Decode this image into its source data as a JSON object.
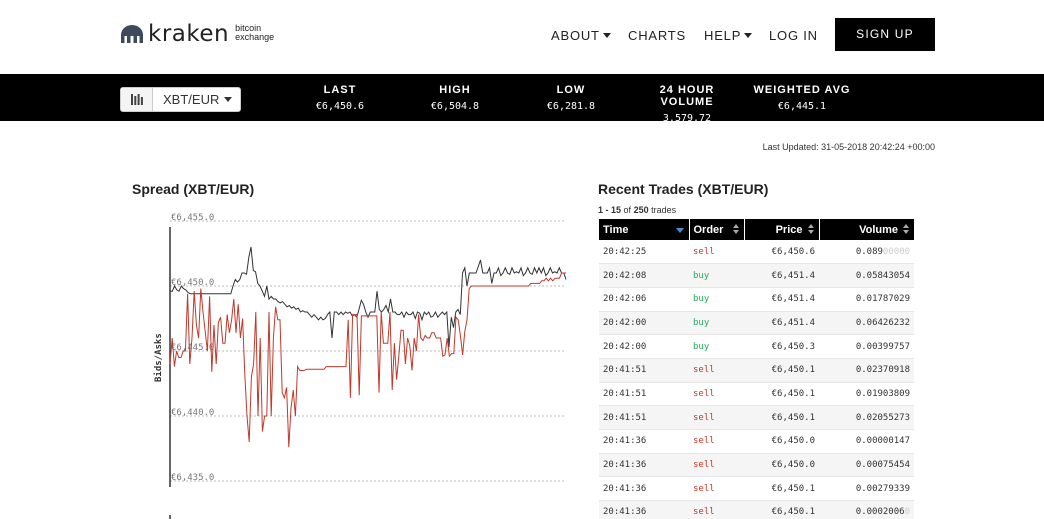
{
  "header": {
    "logo_word": "kraken",
    "logo_sub_1": "bitcoin",
    "logo_sub_2": "exchange",
    "nav": {
      "about": "ABOUT",
      "charts": "CHARTS",
      "help": "HELP",
      "login": "LOG IN",
      "signup": "SIGN UP"
    }
  },
  "ticker": {
    "pair": "XBT/EUR",
    "stats": [
      {
        "label": "LAST",
        "value": "€6,450.6"
      },
      {
        "label": "HIGH",
        "value": "€6,504.8"
      },
      {
        "label": "LOW",
        "value": "€6,281.8"
      },
      {
        "label": "24 HOUR VOLUME",
        "value": "3,579.72"
      },
      {
        "label": "WEIGHTED AVG",
        "value": "€6,445.1"
      }
    ]
  },
  "last_updated": "Last Updated: 31-05-2018 20:42:24 +00:00",
  "spread": {
    "title": "Spread (XBT/EUR)"
  },
  "chart_data": {
    "type": "line",
    "title": "Spread (XBT/EUR)",
    "ylabel": "Bids/Asks",
    "xlabel": "",
    "ylim": [
      6435.0,
      6455.0
    ],
    "yticks": [
      "€6,455.0",
      "€6,450.0",
      "€6,445.0",
      "€6,440.0",
      "€6,435.0"
    ],
    "series": [
      {
        "color": "#333333",
        "values": [
          6449.6,
          6449.6,
          6450.0,
          6449.7,
          6449.6,
          6450.0,
          6449.8,
          6449.7,
          6449.5,
          6449.4,
          6449.4,
          6449.4,
          6449.4,
          6449.4,
          6449.4,
          6449.4,
          6449.4,
          6449.4,
          6449.4,
          6449.4,
          6449.4,
          6449.4,
          6449.4,
          6449.4,
          6449.4,
          6449.4,
          6449.4,
          6449.4,
          6450.0,
          6450.5,
          6450.3,
          6450.5,
          6451.0,
          6451.0,
          6450.9,
          6452.2,
          6453.0,
          6451.2,
          6451.1,
          6450.2,
          6450.0,
          6449.6,
          6449.2,
          6450.0,
          6449.0,
          6449.2,
          6449.0,
          6449.0,
          6448.8,
          6448.7,
          6448.8,
          6448.6,
          6448.4,
          6448.5,
          6448.3,
          6448.4,
          6448.2,
          6448.3,
          6448.0,
          6448.1,
          6448.0,
          6448.0,
          6447.8,
          6447.6,
          6447.8,
          6447.6,
          6447.4,
          6447.6,
          6447.4,
          6447.5,
          6447.8,
          6448.0,
          6446.0,
          6448.0,
          6448.0,
          6447.8,
          6448.0,
          6447.8,
          6448.0,
          6447.9,
          6448.0,
          6447.7,
          6447.8,
          6447.6,
          6448.2,
          6448.9,
          6448.6,
          6448.0,
          6447.6,
          6448.0,
          6448.0,
          6448.0,
          6449.6,
          6448.2,
          6448.0,
          6448.2,
          6448.5,
          6448.0,
          6449.0,
          6448.0,
          6448.0,
          6447.8,
          6447.8,
          6448.0,
          6447.6,
          6448.0,
          6447.8,
          6447.8,
          6448.0,
          6447.5,
          6448.0,
          6447.9,
          6447.4,
          6448.0,
          6447.8,
          6448.0,
          6447.6,
          6447.7,
          6448.0,
          6447.6,
          6447.8,
          6448.0,
          6447.8,
          6448.0,
          6445.3,
          6447.6,
          6446.8,
          6448.0,
          6448.2,
          6447.8,
          6451.0,
          6451.4,
          6450.0,
          6451.0,
          6451.0,
          6451.0,
          6451.0,
          6451.5,
          6452.0,
          6451.0,
          6451.0,
          6451.0,
          6451.4,
          6450.2,
          6451.0,
          6451.0,
          6451.4,
          6450.8,
          6451.0,
          6451.4,
          6451.0,
          6450.9,
          6451.4,
          6451.0,
          6451.1,
          6451.0,
          6451.4,
          6450.8,
          6451.0,
          6451.4,
          6451.0,
          6450.9,
          6451.4,
          6451.0,
          6451.4,
          6451.0,
          6451.4,
          6450.8,
          6451.0,
          6451.4,
          6451.0,
          6451.1,
          6451.0,
          6451.4,
          6451.0,
          6451.0,
          6450.5
        ]
      },
      {
        "color": "#c0392b",
        "values": [
          6444.0,
          6446.0,
          6443.8,
          6445.0,
          6444.5,
          6444.5,
          6445.0,
          6445.0,
          6449.4,
          6444.0,
          6446.0,
          6449.6,
          6447.0,
          6446.0,
          6449.8,
          6448.0,
          6446.5,
          6445.0,
          6449.2,
          6443.4,
          6447.0,
          6444.0,
          6447.2,
          6447.6,
          6445.6,
          6445.6,
          6447.8,
          6446.4,
          6447.4,
          6449.0,
          6446.4,
          6448.6,
          6446.0,
          6447.5,
          6443.2,
          6440.0,
          6438.0,
          6443.0,
          6444.0,
          6448.0,
          6440.0,
          6446.0,
          6438.8,
          6440.0,
          6440.0,
          6448.0,
          6440.0,
          6446.0,
          6448.4,
          6447.4,
          6447.4,
          6441.8,
          6441.4,
          6442.2,
          6437.6,
          6440.6,
          6442.0,
          6440.0,
          6443.8,
          6443.5,
          6443.5,
          6443.5,
          6443.6,
          6443.6,
          6443.6,
          6443.6,
          6443.6,
          6443.6,
          6443.6,
          6443.6,
          6443.6,
          6443.8,
          6443.8,
          6443.8,
          6443.8,
          6443.8,
          6443.8,
          6443.8,
          6443.8,
          6443.8,
          6443.8,
          6447.4,
          6441.4,
          6447.8,
          6447.8,
          6447.8,
          6441.6,
          6447.7,
          6447.7,
          6447.7,
          6447.7,
          6447.7,
          6447.7,
          6447.7,
          6447.7,
          6441.8,
          6448.0,
          6445.6,
          6445.6,
          6445.6,
          6448.0,
          6442.0,
          6445.6,
          6442.8,
          6444.6,
          6446.6,
          6446.6,
          6444.0,
          6446.0,
          6445.4,
          6443.5,
          6446.0,
          6445.0,
          6447.8,
          6446.0,
          6445.8,
          6446.2,
          6446.0,
          6446.0,
          6446.4,
          6446.4,
          6446.0,
          6446.0,
          6446.0,
          6444.6,
          6444.7,
          6446.0,
          6444.6,
          6444.8,
          6444.8,
          6447.6,
          6447.4,
          6446.2,
          6444.7,
          6446.5,
          6447.4,
          6449.8,
          6450.0,
          6450.0,
          6450.0,
          6450.0,
          6450.0,
          6450.0,
          6450.0,
          6450.0,
          6450.0,
          6450.0,
          6450.0,
          6450.0,
          6450.0,
          6450.0,
          6450.0,
          6450.0,
          6450.0,
          6450.0,
          6450.0,
          6450.0,
          6450.0,
          6450.0,
          6450.0,
          6450.0,
          6450.0,
          6450.0,
          6450.0,
          6450.2,
          6450.2,
          6450.2,
          6450.2,
          6450.2,
          6450.4,
          6450.4,
          6450.6,
          6450.4,
          6450.6,
          6450.4,
          6450.6,
          6450.6,
          6450.6,
          6451.0,
          6451.0,
          6451.0
        ]
      }
    ]
  },
  "trades": {
    "title": "Recent Trades (XBT/EUR)",
    "count_prefix": "1 - 15",
    "count_of": "of",
    "count_total": "250",
    "count_suffix": "trades",
    "headers": {
      "time": "Time",
      "order": "Order",
      "price": "Price",
      "volume": "Volume"
    },
    "rows": [
      {
        "time": "20:42:25",
        "order": "sell",
        "price": "€6,450.6",
        "volume": "0.089",
        "volume_faded": "00000"
      },
      {
        "time": "20:42:08",
        "order": "buy",
        "price": "€6,451.4",
        "volume": "0.05843054",
        "volume_faded": ""
      },
      {
        "time": "20:42:06",
        "order": "buy",
        "price": "€6,451.4",
        "volume": "0.01787029",
        "volume_faded": ""
      },
      {
        "time": "20:42:00",
        "order": "buy",
        "price": "€6,451.4",
        "volume": "0.06426232",
        "volume_faded": ""
      },
      {
        "time": "20:42:00",
        "order": "buy",
        "price": "€6,450.3",
        "volume": "0.00399757",
        "volume_faded": ""
      },
      {
        "time": "20:41:51",
        "order": "sell",
        "price": "€6,450.1",
        "volume": "0.02370918",
        "volume_faded": ""
      },
      {
        "time": "20:41:51",
        "order": "sell",
        "price": "€6,450.1",
        "volume": "0.01903809",
        "volume_faded": ""
      },
      {
        "time": "20:41:51",
        "order": "sell",
        "price": "€6,450.1",
        "volume": "0.02055273",
        "volume_faded": ""
      },
      {
        "time": "20:41:36",
        "order": "sell",
        "price": "€6,450.0",
        "volume": "0.00000147",
        "volume_faded": ""
      },
      {
        "time": "20:41:36",
        "order": "sell",
        "price": "€6,450.0",
        "volume": "0.00075454",
        "volume_faded": ""
      },
      {
        "time": "20:41:36",
        "order": "sell",
        "price": "€6,450.1",
        "volume": "0.00279339",
        "volume_faded": ""
      },
      {
        "time": "20:41:36",
        "order": "sell",
        "price": "€6,450.1",
        "volume": "0.0002006",
        "volume_faded": "0"
      }
    ]
  }
}
